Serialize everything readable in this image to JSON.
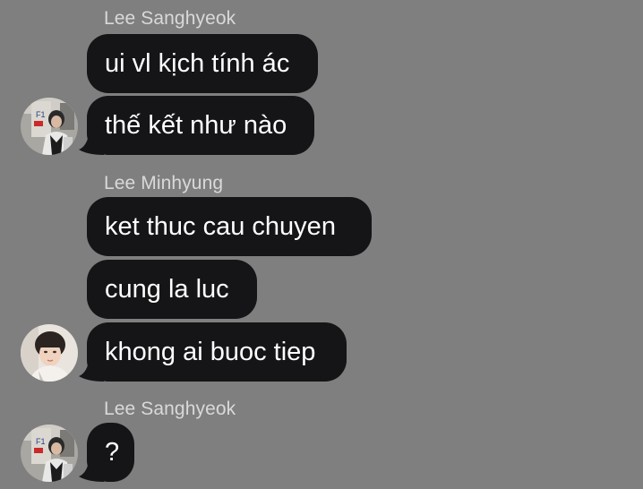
{
  "chat": {
    "groups": [
      {
        "sender": "Lee Sanghyeok",
        "avatar_icon": "user-avatar-faker",
        "messages": [
          "ui vl kịch tính ác",
          "thế kết như nào"
        ]
      },
      {
        "sender": "Lee Minhyung",
        "avatar_icon": "user-avatar-gumayusi",
        "messages": [
          "ket thuc cau chuyen",
          "cung la luc",
          "khong ai buoc tiep"
        ]
      },
      {
        "sender": "Lee Sanghyeok",
        "avatar_icon": "user-avatar-faker",
        "messages": [
          "?"
        ]
      }
    ]
  },
  "colors": {
    "background": "#7f7f7f",
    "bubble": "#151517",
    "bubble_text": "#ffffff",
    "sender_text": "#d9d9d9"
  }
}
